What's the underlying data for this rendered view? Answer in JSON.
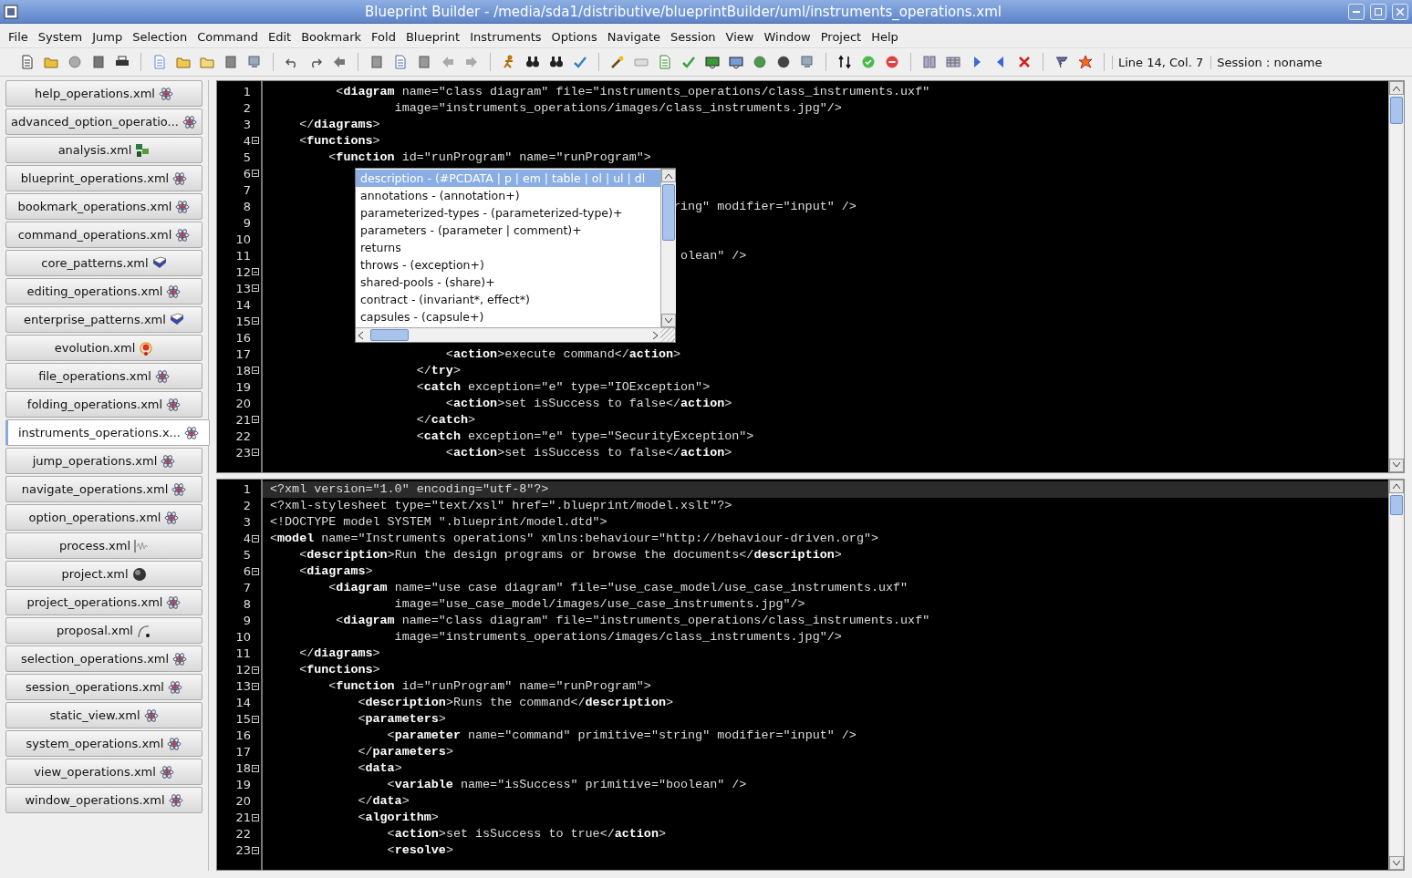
{
  "window": {
    "title": "Blueprint Builder - /media/sda1/distributive/blueprintBuilder/uml/instruments_operations.xml"
  },
  "menu": [
    "File",
    "System",
    "Jump",
    "Selection",
    "Command",
    "Edit",
    "Bookmark",
    "Fold",
    "Blueprint",
    "Instruments",
    "Options",
    "Navigate",
    "Session",
    "View",
    "Window",
    "Project",
    "Help"
  ],
  "status": {
    "position": "Line 14, Col. 7",
    "session": "Session : noname"
  },
  "sidebar": {
    "tabs": [
      {
        "label": "help_operations.xml",
        "kind": "atom",
        "selected": false
      },
      {
        "label": "advanced_option_operatio...",
        "kind": "atom",
        "selected": false
      },
      {
        "label": "analysis.xml",
        "kind": "blocks",
        "selected": false
      },
      {
        "label": "blueprint_operations.xml",
        "kind": "atom",
        "selected": false
      },
      {
        "label": "bookmark_operations.xml",
        "kind": "atom",
        "selected": false
      },
      {
        "label": "command_operations.xml",
        "kind": "atom",
        "selected": false
      },
      {
        "label": "core_patterns.xml",
        "kind": "book",
        "selected": false
      },
      {
        "label": "editing_operations.xml",
        "kind": "atom",
        "selected": false
      },
      {
        "label": "enterprise_patterns.xml",
        "kind": "book",
        "selected": false
      },
      {
        "label": "evolution.xml",
        "kind": "molecule",
        "selected": false
      },
      {
        "label": "file_operations.xml",
        "kind": "atom",
        "selected": false
      },
      {
        "label": "folding_operations.xml",
        "kind": "atom",
        "selected": false
      },
      {
        "label": "instruments_operations.x...",
        "kind": "atom",
        "selected": true
      },
      {
        "label": "jump_operations.xml",
        "kind": "atom",
        "selected": false
      },
      {
        "label": "navigate_operations.xml",
        "kind": "atom",
        "selected": false
      },
      {
        "label": "option_operations.xml",
        "kind": "atom",
        "selected": false
      },
      {
        "label": "process.xml",
        "kind": "wave",
        "selected": false
      },
      {
        "label": "project.xml",
        "kind": "sphere",
        "selected": false
      },
      {
        "label": "project_operations.xml",
        "kind": "atom",
        "selected": false
      },
      {
        "label": "proposal.xml",
        "kind": "curve",
        "selected": false
      },
      {
        "label": "selection_operations.xml",
        "kind": "atom",
        "selected": false
      },
      {
        "label": "session_operations.xml",
        "kind": "atom",
        "selected": false
      },
      {
        "label": "static_view.xml",
        "kind": "atom",
        "selected": false
      },
      {
        "label": "system_operations.xml",
        "kind": "atom",
        "selected": false
      },
      {
        "label": "view_operations.xml",
        "kind": "atom",
        "selected": false
      },
      {
        "label": "window_operations.xml",
        "kind": "atom",
        "selected": false
      }
    ]
  },
  "top_editor": {
    "lines": [
      {
        "number": "1",
        "fold": false,
        "code": "         <**diagram** name=\"class diagram\" file=\"instruments_operations/class_instruments.uxf\""
      },
      {
        "number": "2",
        "fold": false,
        "code": "                 image=\"instruments_operations/images/class_instruments.jpg\"/>"
      },
      {
        "number": "3",
        "fold": false,
        "code": "    </**diagrams**>"
      },
      {
        "number": "4",
        "fold": true,
        "code": "    <**functions**>"
      },
      {
        "number": "5",
        "fold": false,
        "code": "        <**function** id=\"runProgram\" name=\"runProgram\">"
      },
      {
        "number": "6",
        "fold": true
      },
      {
        "number": "7",
        "fold": false
      },
      {
        "number": "8",
        "fold": false,
        "code": "                                                       ring\" modifier=\"input\" />"
      },
      {
        "number": "9",
        "fold": false
      },
      {
        "number": "10",
        "fold": false
      },
      {
        "number": "11",
        "fold": false,
        "code": "                                                        olean\" />"
      },
      {
        "number": "12",
        "fold": true
      },
      {
        "number": "13",
        "fold": true
      },
      {
        "number": "14",
        "fold": false
      },
      {
        "number": "15",
        "fold": true
      },
      {
        "number": "16",
        "fold": false
      },
      {
        "number": "17",
        "fold": false,
        "code": "                        <**action**>execute command</**action**>"
      },
      {
        "number": "18",
        "fold": true,
        "code": "                    </**try**>"
      },
      {
        "number": "19",
        "fold": false,
        "code": "                    <**catch** exception=\"e\" type=\"IOException\">"
      },
      {
        "number": "20",
        "fold": false,
        "code": "                        <**action**>set isSuccess to false</**action**>"
      },
      {
        "number": "21",
        "fold": true,
        "code": "                    </**catch**>"
      },
      {
        "number": "22",
        "fold": false,
        "code": "                    <**catch** exception=\"e\" type=\"SecurityException\">"
      },
      {
        "number": "23",
        "fold": true,
        "code": "                        <**action**>set isSuccess to false</**action**>"
      }
    ],
    "completion": [
      {
        "label": "description - (#PCDATA | p | em | table | ol | ul | dl",
        "selected": true
      },
      {
        "label": "annotations - (annotation+)",
        "selected": false
      },
      {
        "label": "parameterized-types - (parameterized-type)+",
        "selected": false
      },
      {
        "label": "parameters - (parameter | comment)+",
        "selected": false
      },
      {
        "label": "returns",
        "selected": false
      },
      {
        "label": "throws - (exception+)",
        "selected": false
      },
      {
        "label": "shared-pools - (share)+",
        "selected": false
      },
      {
        "label": "contract - (invariant*, effect*)",
        "selected": false
      },
      {
        "label": "capsules - (capsule+)",
        "selected": false
      }
    ]
  },
  "bottom_editor": {
    "lines": [
      {
        "number": "1",
        "fold": false,
        "current": true,
        "code": "<?xml version=\"1.0\" encoding=\"utf-8\"?>"
      },
      {
        "number": "2",
        "fold": false,
        "current": false,
        "code": "<?xml-stylesheet type=\"text/xsl\" href=\".blueprint/model.xslt\"?>"
      },
      {
        "number": "3",
        "fold": false,
        "current": false,
        "code": "<!DOCTYPE model SYSTEM \".blueprint/model.dtd\">"
      },
      {
        "number": "4",
        "fold": true,
        "current": false,
        "code": "<**model** name=\"Instruments operations\" xmlns:behaviour=\"http://behaviour-driven.org\">"
      },
      {
        "number": "5",
        "fold": false,
        "current": false,
        "code": "    <**description**>Run the design programs or browse the documents</**description**>"
      },
      {
        "number": "6",
        "fold": true,
        "current": false,
        "code": "    <**diagrams**>"
      },
      {
        "number": "7",
        "fold": false,
        "current": false,
        "code": "        <**diagram** name=\"use case diagram\" file=\"use_case_model/use_case_instruments.uxf\""
      },
      {
        "number": "8",
        "fold": false,
        "current": false,
        "code": "                 image=\"use_case_model/images/use_case_instruments.jpg\"/>"
      },
      {
        "number": "9",
        "fold": false,
        "current": false,
        "code": "         <**diagram** name=\"class diagram\" file=\"instruments_operations/class_instruments.uxf\""
      },
      {
        "number": "10",
        "fold": false,
        "current": false,
        "code": "                 image=\"instruments_operations/images/class_instruments.jpg\"/>"
      },
      {
        "number": "11",
        "fold": false,
        "current": false,
        "code": "    </**diagrams**>"
      },
      {
        "number": "12",
        "fold": true,
        "current": false,
        "code": "    <**functions**>"
      },
      {
        "number": "13",
        "fold": true,
        "current": false,
        "code": "        <**function** id=\"runProgram\" name=\"runProgram\">"
      },
      {
        "number": "14",
        "fold": false,
        "current": false,
        "code": "            <**description**>Runs the command</**description**>"
      },
      {
        "number": "15",
        "fold": true,
        "current": false,
        "code": "            <**parameters**>"
      },
      {
        "number": "16",
        "fold": false,
        "current": false,
        "code": "                <**parameter** name=\"command\" primitive=\"string\" modifier=\"input\" />"
      },
      {
        "number": "17",
        "fold": false,
        "current": false,
        "code": "            </**parameters**>"
      },
      {
        "number": "18",
        "fold": true,
        "current": false,
        "code": "            <**data**>"
      },
      {
        "number": "19",
        "fold": false,
        "current": false,
        "code": "                <**variable** name=\"isSuccess\" primitive=\"boolean\" />"
      },
      {
        "number": "20",
        "fold": false,
        "current": false,
        "code": "            </**data**>"
      },
      {
        "number": "21",
        "fold": true,
        "current": false,
        "code": "            <**algorithm**>"
      },
      {
        "number": "22",
        "fold": false,
        "current": false,
        "code": "                <**action**>set isSuccess to true</**action**>"
      },
      {
        "number": "23",
        "fold": true,
        "current": false,
        "code": "                <**resolve**>"
      }
    ]
  }
}
